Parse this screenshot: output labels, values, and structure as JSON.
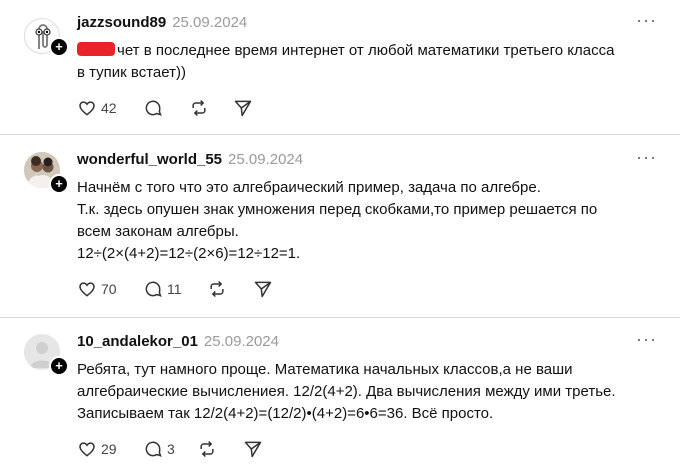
{
  "posts": [
    {
      "username": "jazzsound89",
      "date": "25.09.2024",
      "text_lines": [
        "чет в последнее время интернет от любой математики третьего класса",
        "в тупик встает))"
      ],
      "likes": "42",
      "comments": "",
      "avatar_icon": "clippy-icon"
    },
    {
      "username": "wonderful_world_55",
      "date": "25.09.2024",
      "text_lines": [
        "Начнём с того что это алгебраический пример, задача по алгебре.",
        "Т.к. здесь опушен знак умножения перед скобками,то пример решается по",
        "всем законам алгебры.",
        "12÷(2×(4+2)=12÷(2×6)=12÷12=1."
      ],
      "likes": "70",
      "comments": "11",
      "avatar_icon": "photo-avatar"
    },
    {
      "username": "10_andalekor_01",
      "date": "25.09.2024",
      "text_lines": [
        "Ребята, тут намного проще. Математика начальных классов,а не ваши",
        "алгебраические вычислениея. 12/2(4+2). Два вычисления между ими третье.",
        "Записываем так 12/2(4+2)=(12/2)•(4+2)=6•6=36. Всё просто."
      ],
      "likes": "29",
      "comments": "3",
      "avatar_icon": "default-avatar"
    }
  ],
  "colors": {
    "redaction": "#e8232a",
    "divider": "#d9d9d9",
    "date": "#9a9a9a"
  }
}
